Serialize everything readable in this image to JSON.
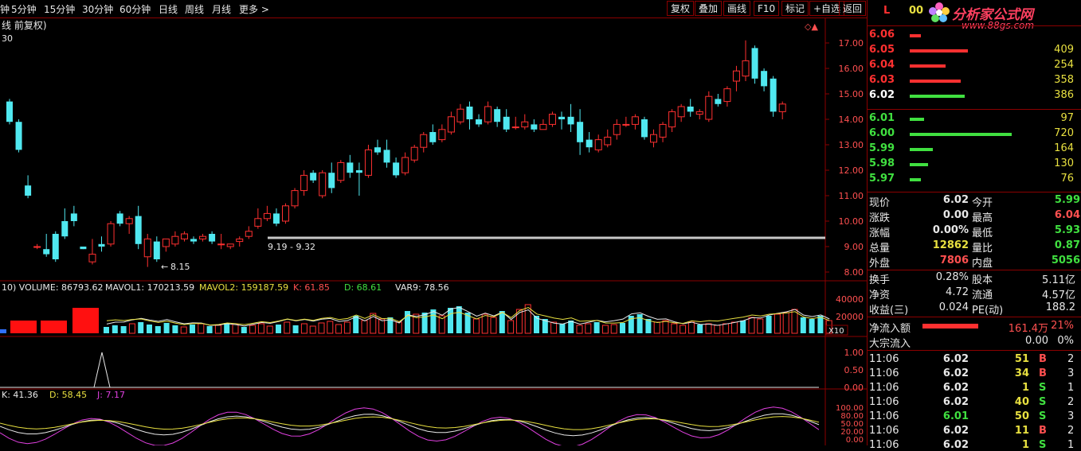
{
  "toolbar": {
    "timeframes": [
      "钟",
      "5分钟",
      "15分钟",
      "30分钟",
      "60分钟",
      "日线",
      "周线",
      "月线",
      "更多 >"
    ],
    "buttons": [
      "复权",
      "叠加",
      "画线",
      "F10",
      "标记",
      "+自选",
      "返回"
    ]
  },
  "main_chart": {
    "title": "线 前复权)",
    "subtitle": "30",
    "y_ticks": [
      "17.00",
      "16.00",
      "15.00",
      "14.00",
      "13.00",
      "12.00",
      "11.00",
      "10.00",
      "9.00",
      "8.00"
    ],
    "low_label": "8.15",
    "range_label": "9.19 - 9.32"
  },
  "volume_panel": {
    "legend": [
      {
        "text": "10) VOLUME: 86793.62",
        "color": "#e8e8e8"
      },
      {
        "text": "MAVOL1: 170213.59",
        "color": "#e8e8e8"
      },
      {
        "text": "MAVOL2: 159187.59",
        "color": "#e8e040"
      },
      {
        "text": "K: 61.85",
        "color": "#ff5050"
      },
      {
        "text": "D: 68.61",
        "color": "#40e040"
      },
      {
        "text": "VAR9: 78.56",
        "color": "#e8e8e8"
      }
    ],
    "y_ticks": [
      "40000",
      "20000"
    ],
    "unit": "X10"
  },
  "signal_panel": {
    "y_ticks": [
      "1.00",
      "0.50",
      "0.00"
    ]
  },
  "kdj_panel": {
    "legend": [
      {
        "text": "K: 41.36",
        "color": "#e8e8e8"
      },
      {
        "text": "D: 58.45",
        "color": "#e8e040"
      },
      {
        "text": "J: 7.17",
        "color": "#e040e0"
      }
    ],
    "y_ticks": [
      "100.00",
      "80.00",
      "50.00",
      "20.00",
      "0.00"
    ]
  },
  "right_panel": {
    "header_left": "L",
    "header_code": "00",
    "logo_text": "分析家公式网",
    "logo_url": "www.88gs.com",
    "asks": [
      {
        "price": "6.06",
        "vol": "",
        "bar": 0.11
      },
      {
        "price": "6.05",
        "vol": "409",
        "bar": 0.57
      },
      {
        "price": "6.04",
        "vol": "254",
        "bar": 0.35
      },
      {
        "price": "6.03",
        "vol": "358",
        "bar": 0.5
      },
      {
        "price": "6.02",
        "vol": "386",
        "bar": 0.54
      }
    ],
    "bids": [
      {
        "price": "6.01",
        "vol": "97",
        "bar": 0.14
      },
      {
        "price": "6.00",
        "vol": "720",
        "bar": 1.0
      },
      {
        "price": "5.99",
        "vol": "164",
        "bar": 0.23
      },
      {
        "price": "5.98",
        "vol": "130",
        "bar": 0.18
      },
      {
        "price": "5.97",
        "vol": "76",
        "bar": 0.11
      }
    ],
    "quote": [
      {
        "l1": "现价",
        "v1": "6.02",
        "c1": "#e8e8e8",
        "l2": "今开",
        "v2": "5.99",
        "c2": "#40e040"
      },
      {
        "l1": "涨跌",
        "v1": "0.00",
        "c1": "#e8e8e8",
        "l2": "最高",
        "v2": "6.04",
        "c2": "#ff5050"
      },
      {
        "l1": "涨幅",
        "v1": "0.00%",
        "c1": "#e8e8e8",
        "l2": "最低",
        "v2": "5.93",
        "c2": "#40e040"
      },
      {
        "l1": "总量",
        "v1": "12862",
        "c1": "#e8e040",
        "l2": "量比",
        "v2": "0.87",
        "c2": "#40e040"
      },
      {
        "l1": "外盘",
        "v1": "7806",
        "c1": "#ff5050",
        "l2": "内盘",
        "v2": "5056",
        "c2": "#40e040"
      }
    ],
    "info": [
      {
        "l1": "换手",
        "v1": "0.28%",
        "l2": "股本",
        "v2": "5.11亿"
      },
      {
        "l1": "净资",
        "v1": "4.72",
        "l2": "流通",
        "v2": "4.57亿"
      },
      {
        "l1": "收益(三)",
        "v1": "0.024",
        "l2": "PE(动)",
        "v2": "188.2"
      }
    ],
    "netflow": {
      "label": "净流入额",
      "value": "161.4万",
      "pct": "21%",
      "bar": 1.0
    },
    "block": {
      "label": "大宗流入",
      "value": "0.00",
      "pct": "0%"
    },
    "ticks": [
      {
        "time": "11:06",
        "price": "6.02",
        "pc": "#e8e8e8",
        "vol": "51",
        "side": "B",
        "n": "2"
      },
      {
        "time": "11:06",
        "price": "6.02",
        "pc": "#e8e8e8",
        "vol": "34",
        "side": "B",
        "n": "3"
      },
      {
        "time": "11:06",
        "price": "6.02",
        "pc": "#e8e8e8",
        "vol": "1",
        "side": "S",
        "n": "1"
      },
      {
        "time": "11:06",
        "price": "6.02",
        "pc": "#e8e8e8",
        "vol": "40",
        "side": "S",
        "n": "2"
      },
      {
        "time": "11:06",
        "price": "6.01",
        "pc": "#40e040",
        "vol": "50",
        "side": "S",
        "n": "3"
      },
      {
        "time": "11:06",
        "price": "6.02",
        "pc": "#e8e8e8",
        "vol": "11",
        "side": "B",
        "n": "2"
      },
      {
        "time": "11:06",
        "price": "6.02",
        "pc": "#e8e8e8",
        "vol": "1",
        "side": "S",
        "n": "1"
      }
    ]
  },
  "colors": {
    "up": "#ff3030",
    "down": "#50e8f0",
    "border": "#8b0000",
    "green": "#40e040",
    "yellow": "#e8e040"
  }
}
